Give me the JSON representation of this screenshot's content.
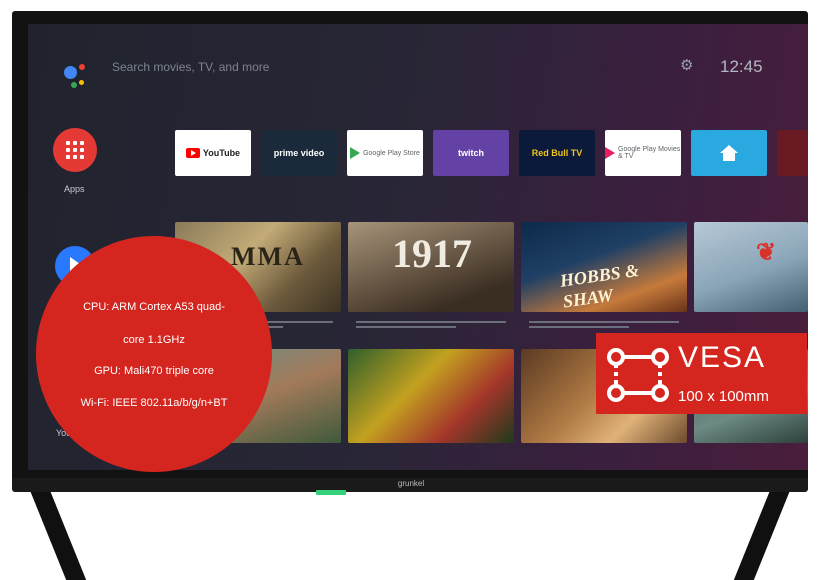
{
  "home": {
    "search_placeholder": "Search movies, TV, and more",
    "clock": "12:45",
    "apps_label": "Apps",
    "youtube_label": "YouTube"
  },
  "apps_row": [
    {
      "label": "YouTube"
    },
    {
      "label": "prime video"
    },
    {
      "label": "Google Play Store"
    },
    {
      "label": "twitch"
    },
    {
      "label": "Red Bull TV"
    },
    {
      "label": "Google Play Movies & TV"
    }
  ],
  "posters": {
    "p1": "MMA",
    "p2": "1917",
    "p3": "HOBBS & SHAW"
  },
  "device": {
    "brand": "grunkel"
  },
  "specs": [
    "CPU: ARM Cortex A53 quad-",
    "core 1.1GHz",
    "GPU: Mali470 triple core",
    "Wi-Fi: IEEE 802.11a/b/g/n+BT"
  ],
  "vesa": {
    "title": "VESA",
    "size": "100 x 100mm"
  },
  "colors": {
    "accent_red": "#d4261f",
    "apps_red": "#e53935",
    "twitch_purple": "#6441a5",
    "home_blue": "#2aa8e0"
  }
}
